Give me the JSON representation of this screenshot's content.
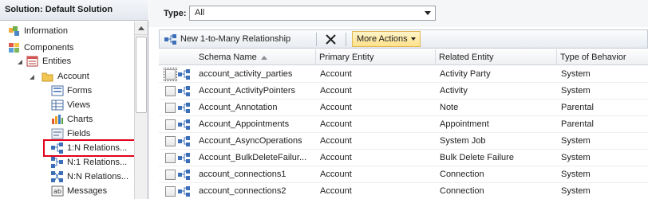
{
  "nav": {
    "title": "Solution: Default Solution",
    "items": [
      {
        "label": "Information",
        "icon": "information-icon"
      },
      {
        "label": "Components",
        "icon": "components-icon"
      },
      {
        "label": "Entities",
        "icon": "entities-icon"
      },
      {
        "label": "Account",
        "icon": "folder-icon"
      },
      {
        "label": "Forms",
        "icon": "forms-icon"
      },
      {
        "label": "Views",
        "icon": "views-icon"
      },
      {
        "label": "Charts",
        "icon": "charts-icon"
      },
      {
        "label": "Fields",
        "icon": "fields-icon"
      },
      {
        "label": "1:N Relations...",
        "icon": "relationship-icon"
      },
      {
        "label": "N:1 Relations...",
        "icon": "relationship-icon"
      },
      {
        "label": "N:N Relations...",
        "icon": "relationship-icon"
      },
      {
        "label": "Messages",
        "icon": "messages-icon"
      }
    ]
  },
  "filter": {
    "type_label": "Type:",
    "type_value": "All"
  },
  "toolbar": {
    "new_label": "New 1-to-Many Relationship",
    "more_actions_label": "More Actions"
  },
  "grid": {
    "columns": [
      "Schema Name",
      "Primary Entity",
      "Related Entity",
      "Type of Behavior"
    ],
    "rows": [
      [
        "account_activity_parties",
        "Account",
        "Activity Party",
        "System"
      ],
      [
        "Account_ActivityPointers",
        "Account",
        "Activity",
        "System"
      ],
      [
        "Account_Annotation",
        "Account",
        "Note",
        "Parental"
      ],
      [
        "Account_Appointments",
        "Account",
        "Appointment",
        "Parental"
      ],
      [
        "Account_AsyncOperations",
        "Account",
        "System Job",
        "System"
      ],
      [
        "Account_BulkDeleteFailur...",
        "Account",
        "Bulk Delete Failure",
        "System"
      ],
      [
        "account_connections1",
        "Account",
        "Connection",
        "System"
      ],
      [
        "account_connections2",
        "Account",
        "Connection",
        "System"
      ]
    ]
  },
  "colors": {
    "selection_border": "#e3001b",
    "more_actions_bg": "#ffe28a"
  }
}
